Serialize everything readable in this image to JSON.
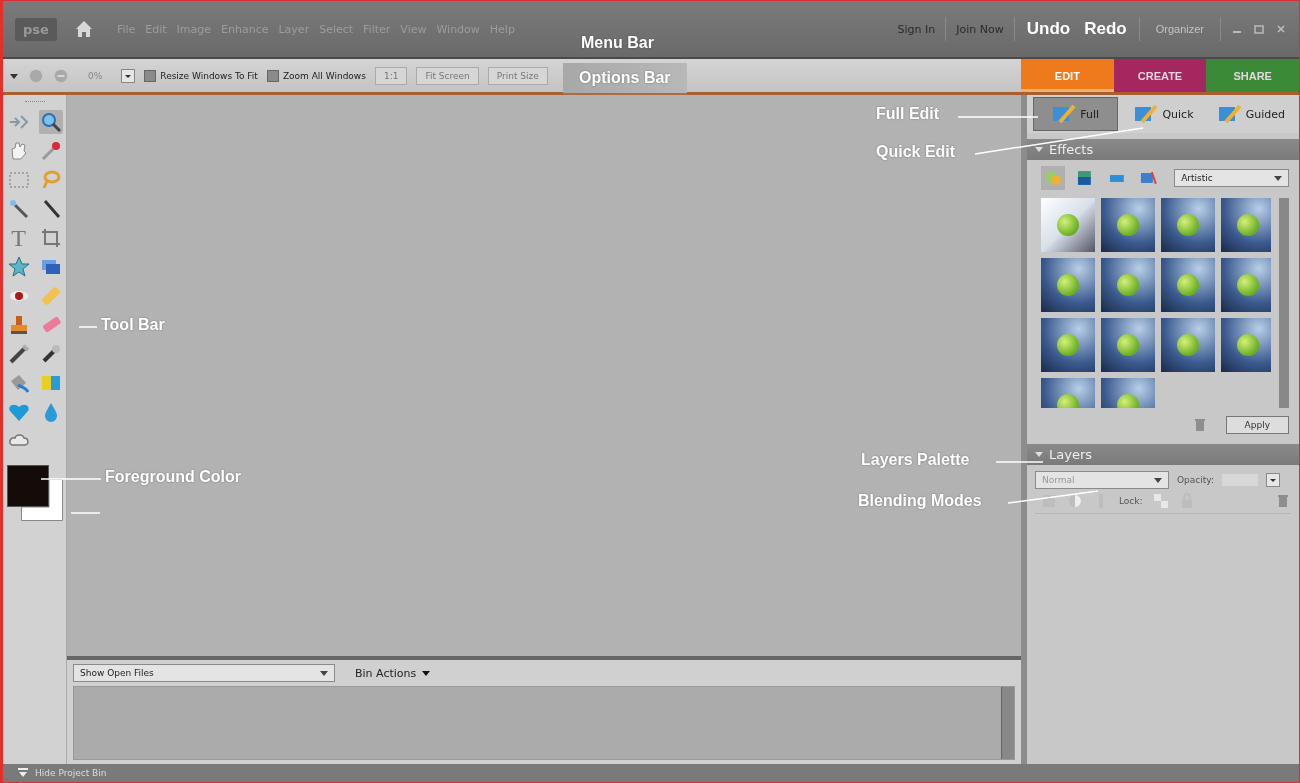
{
  "menu_bar": {
    "logo": "pse",
    "menus": [
      "File",
      "Edit",
      "Image",
      "Enhance",
      "Layer",
      "Select",
      "Filter",
      "View",
      "Window",
      "Help"
    ],
    "sign_in": "Sign In",
    "join_now": "Join Now",
    "undo": "Undo",
    "redo": "Redo",
    "organizer": "Organizer"
  },
  "options_bar": {
    "zoom_value": "0%",
    "checkboxes": [
      {
        "label": "Resize Windows To Fit",
        "checked": false
      },
      {
        "label": "Zoom All Windows",
        "checked": false
      }
    ],
    "buttons": [
      "1:1",
      "Fit Screen",
      "Print Size"
    ]
  },
  "workspace_tabs": [
    {
      "label": "EDIT",
      "selected": true,
      "color": "#ee7a1c"
    },
    {
      "label": "CREATE",
      "selected": false,
      "color": "#a4275f"
    },
    {
      "label": "SHARE",
      "selected": false,
      "color": "#3a8a38"
    }
  ],
  "edit_modes": [
    {
      "label": "Full",
      "selected": true
    },
    {
      "label": "Quick",
      "selected": false
    },
    {
      "label": "Guided",
      "selected": false
    }
  ],
  "toolbar": {
    "type_tool_glyph": "T"
  },
  "effects_panel": {
    "title": "Effects",
    "category": "Artistic",
    "apply": "Apply"
  },
  "layers_panel": {
    "title": "Layers",
    "blend_mode": "Normal",
    "opacity_label": "Opacity:",
    "lock_label": "Lock:"
  },
  "project_bin": {
    "show": "Show Open Files",
    "actions": "Bin Actions"
  },
  "status_bar": {
    "toggle": "Hide Project Bin"
  },
  "annotations": [
    {
      "text": "Menu Bar"
    },
    {
      "text": "Options Bar"
    },
    {
      "text": "Full Edit"
    },
    {
      "text": "Quick Edit"
    },
    {
      "text": "Tool Bar"
    },
    {
      "text": "Foreground Color"
    },
    {
      "text": "Layers Palette"
    },
    {
      "text": "Blending Modes"
    }
  ]
}
